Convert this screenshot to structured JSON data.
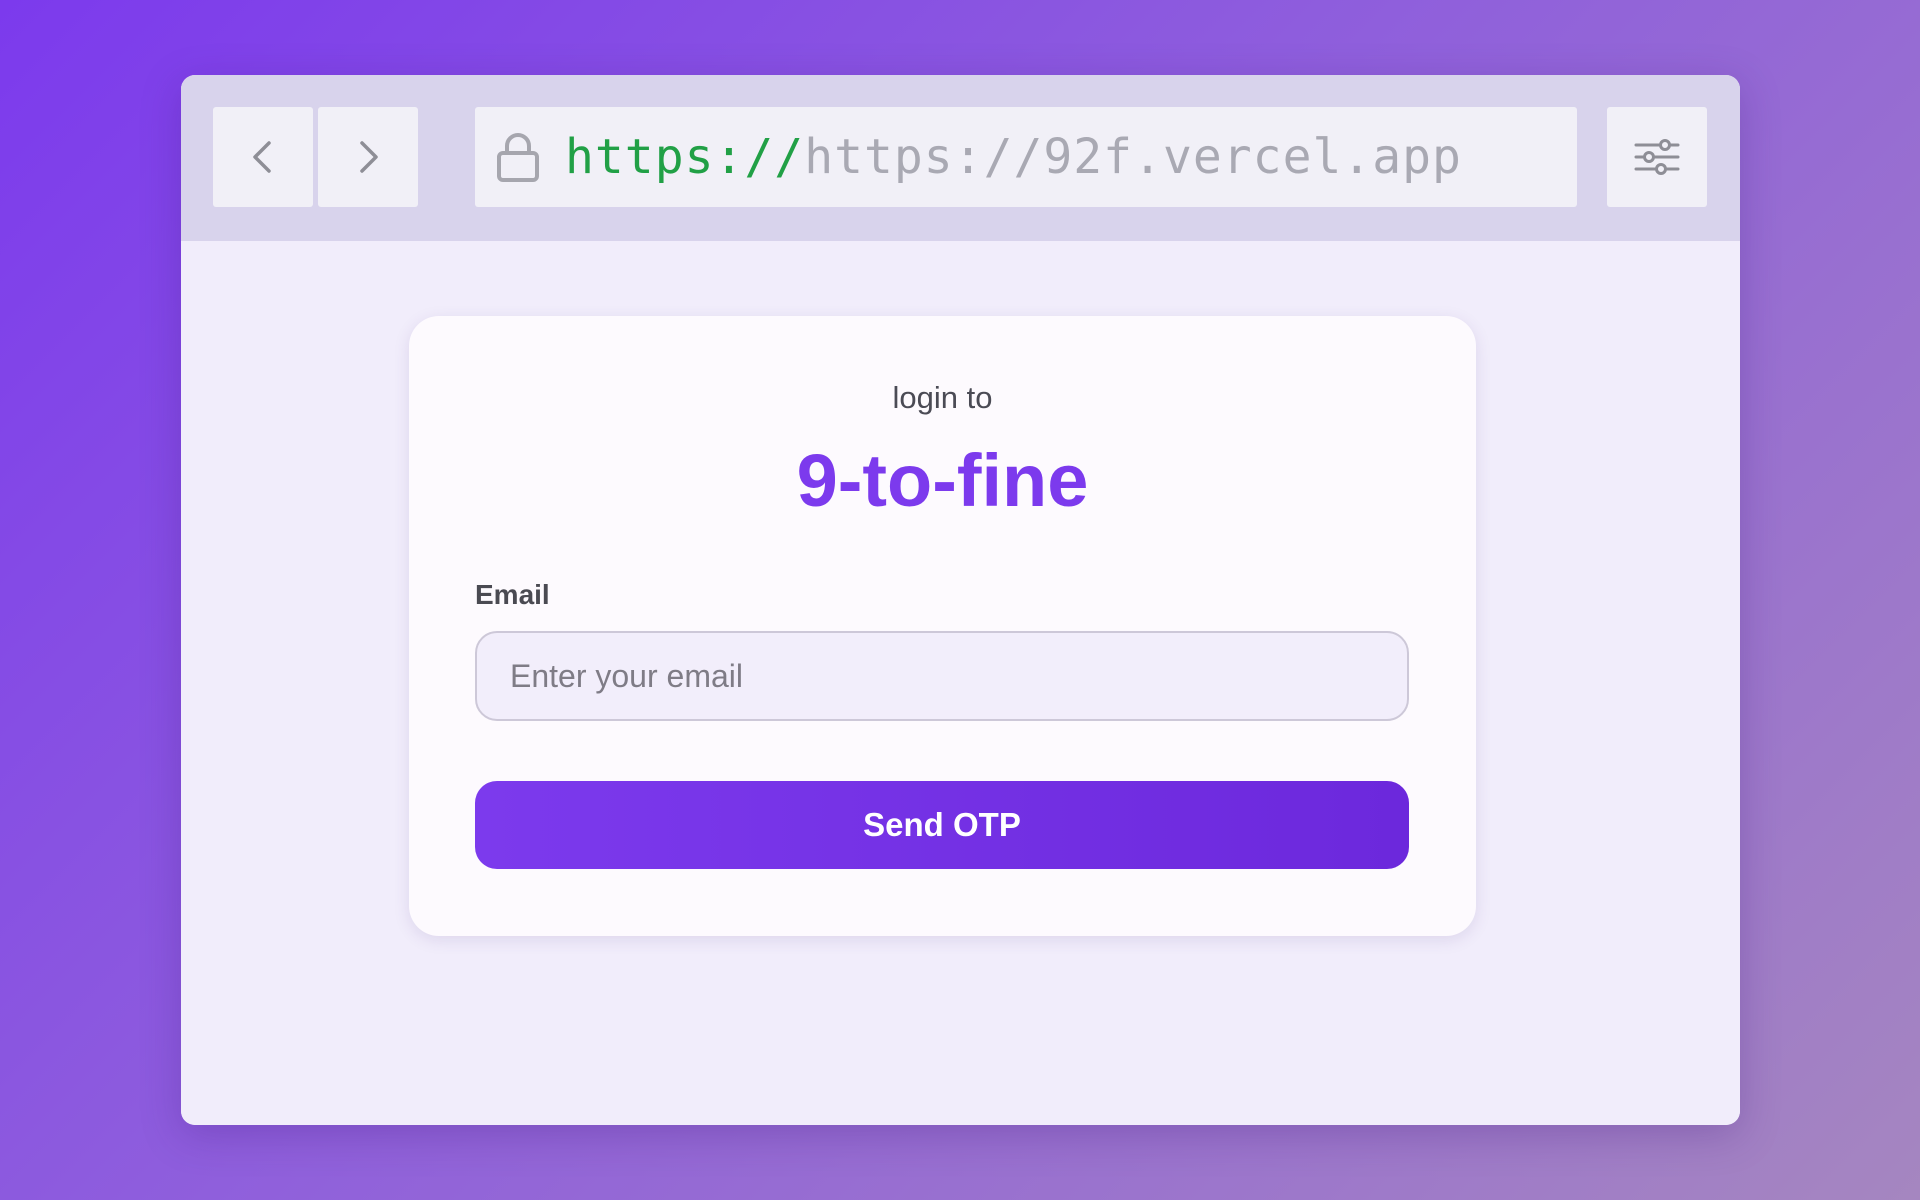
{
  "browser": {
    "url_scheme": "https://",
    "url_host": "https://92f.vercel.app",
    "back_icon": "chevron-left-icon",
    "forward_icon": "chevron-right-icon",
    "lock_icon": "lock-icon",
    "settings_icon": "sliders-icon"
  },
  "login": {
    "intro": "login to",
    "brand": "9-to-fine",
    "email_label": "Email",
    "email_placeholder": "Enter your email",
    "email_value": "",
    "submit_label": "Send OTP"
  },
  "colors": {
    "accent": "#7c3aed",
    "url_scheme": "#21a046",
    "url_host": "#a9a9b3"
  }
}
